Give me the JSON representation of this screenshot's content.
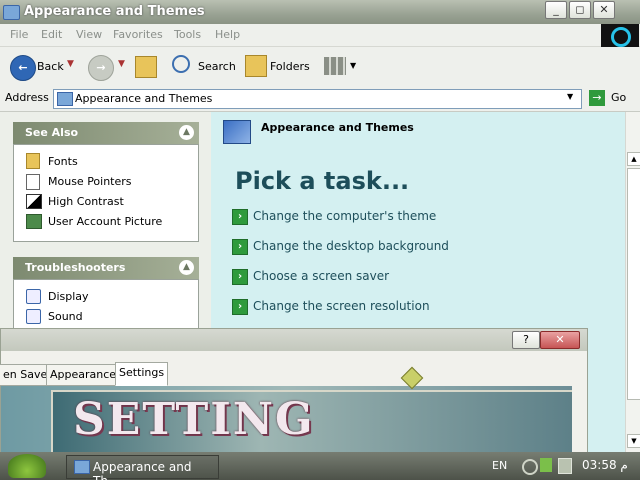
{
  "window": {
    "title": "Appearance and Themes"
  },
  "menu": [
    "File",
    "Edit",
    "View",
    "Favorites",
    "Tools",
    "Help"
  ],
  "toolbar": {
    "back": "Back",
    "search": "Search",
    "folders": "Folders"
  },
  "address": {
    "label": "Address",
    "value": "Appearance and Themes",
    "go": "Go"
  },
  "see_also": {
    "title": "See Also",
    "items": [
      "Fonts",
      "Mouse Pointers",
      "High Contrast",
      "User Account Picture"
    ]
  },
  "troubleshooters": {
    "title": "Troubleshooters",
    "items": [
      "Display",
      "Sound"
    ]
  },
  "main": {
    "header": "Appearance and Themes",
    "pick_task": "Pick a task...",
    "tasks": [
      "Change the computer's theme",
      "Change the desktop background",
      "Choose a screen saver",
      "Change the screen resolution"
    ]
  },
  "dialog": {
    "help": "?",
    "close": "✕",
    "tabs": [
      "en Saver",
      "Appearance",
      "Settings"
    ],
    "banner_text": "SETTING"
  },
  "taskbar": {
    "task_button": "Appearance and Th...",
    "lang": "EN",
    "time": "03:58 م"
  },
  "colors": {
    "right_pane": "#d4f0f1",
    "task_text": "#1d4e5a",
    "panel_header": "#7d8a70"
  }
}
